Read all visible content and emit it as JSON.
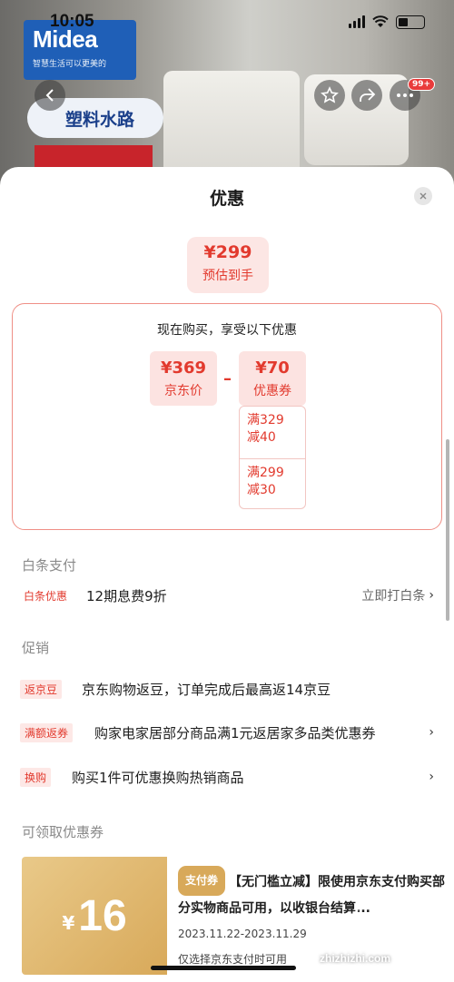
{
  "status_bar": {
    "time": "10:05"
  },
  "background": {
    "brand": "Midea",
    "brand_tagline": "智慧生活可以更美的",
    "banner_text": "塑料水路",
    "cart_badge": "99+"
  },
  "sheet": {
    "title": "优惠",
    "estimate": {
      "price": "¥299",
      "label": "预估到手"
    },
    "calc": {
      "heading": "现在购买，享受以下优惠",
      "jd_price": {
        "value": "¥369",
        "label": "京东价"
      },
      "minus": "–",
      "coupon": {
        "value": "¥70",
        "label": "优惠券"
      },
      "coupon_items": [
        {
          "line1": "满329",
          "line2": "减40"
        },
        {
          "line1": "满299",
          "line2": "减30"
        }
      ]
    },
    "baitiao": {
      "section_title": "白条支付",
      "tag": "白条优惠",
      "text": "12期息费9折",
      "action": "立即打白条"
    },
    "promotions": {
      "section_title": "促销",
      "items": [
        {
          "tag": "返京豆",
          "text": "京东购物返豆，订单完成后最高返14京豆"
        },
        {
          "tag": "满额返券",
          "text": "购家电家居部分商品满1元返居家多品类优惠券"
        },
        {
          "tag": "换购",
          "text": "购买1件可优惠换购热销商品"
        }
      ]
    },
    "coupons": {
      "section_title": "可领取优惠券",
      "card": {
        "currency": "¥",
        "amount": "16",
        "pay_tag": "支付券",
        "title": "【无门槛立减】限使用京东支付购买部分实物商品可用，以收银台结算...",
        "date": "2023.11.22-2023.11.29",
        "note": "仅选择京东支付时可用"
      }
    }
  },
  "watermark": "zhizhizhi.com",
  "colors": {
    "accent_red": "#e23a2e",
    "coupon_gold": "#d8a95a"
  }
}
